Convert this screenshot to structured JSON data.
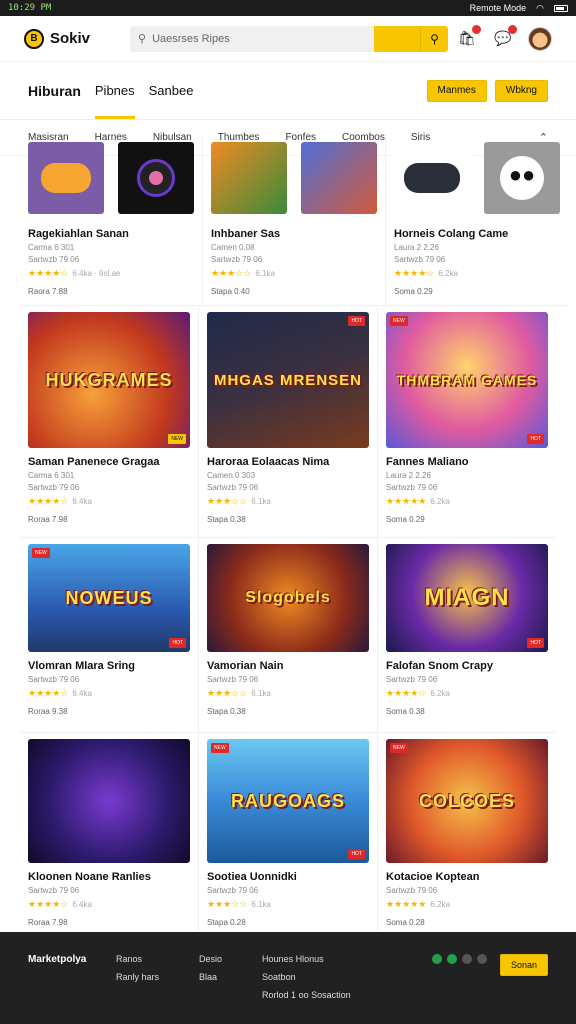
{
  "status": {
    "left": "10:29 PM",
    "right_text": "Remote Mode"
  },
  "header": {
    "logo_mark": "B",
    "logo_text": "Sokiv",
    "search_placeholder": "Uaesrses Ripes",
    "icons": [
      "bag-icon",
      "chat-icon",
      "avatar"
    ]
  },
  "tabs": [
    {
      "label": "Hiburan"
    },
    {
      "label": "Pibnes"
    },
    {
      "label": "Sanbee"
    }
  ],
  "tab_actions": [
    "Manmes",
    "Wbkng"
  ],
  "categories": [
    "Masisran",
    "Harnes",
    "Nibulsan",
    "Thumbes",
    "Fonfes",
    "Coombos",
    "Siris"
  ],
  "rows": [
    {
      "type": "thumbs",
      "cells": [
        {
          "title": "Ragekiahlan Sanan",
          "sub1": "Carma 6 301",
          "sub2": "Sartwzb 79 06",
          "stars": "★★★★☆",
          "rating": "6.4ka · 9sl.ae",
          "price": "Raora 7.88"
        },
        {
          "title": "Inhbaner Sas",
          "sub1": "Camen 0.08",
          "sub2": "Sartwzb 79 06",
          "stars": "★★★☆☆",
          "rating": "6.1ka",
          "price": "Stapa 0.40"
        },
        {
          "title": "Horneis Colang Came",
          "sub1": "Laura 2 2.26",
          "sub2": "Sartwzb 79 06",
          "stars": "★★★★☆",
          "rating": "6.2ka",
          "price": "Soma 0.29"
        }
      ]
    },
    {
      "type": "banner",
      "cells": [
        {
          "banner": "HUKGRAMES",
          "title": "Saman Panenece Gragaa",
          "sub1": "Carma 6 301",
          "sub2": "Sartwzb 79 06",
          "stars": "★★★★☆",
          "rating": "6.4ka",
          "price": "Roraa 7.98"
        },
        {
          "banner": "MHGAS MRENSEN",
          "title": "Haroraa Eolaacas Nima",
          "sub1": "Camen 0 303",
          "sub2": "Sartwzb 79 06",
          "stars": "★★★☆☆",
          "rating": "6.1ka",
          "price": "Stapa 0.38"
        },
        {
          "banner": "THMBRAM GAMES",
          "title": "Fannes Maliano",
          "sub1": "Laura 2 2.26",
          "sub2": "Sartwzb 79 06",
          "stars": "★★★★★",
          "rating": "6.2ka",
          "price": "Soma 0.29"
        }
      ]
    },
    {
      "type": "banner",
      "cells": [
        {
          "banner": "NOWEUS",
          "title": "Vlomran Mlara Sring",
          "sub1": "Sartwzb 79 06",
          "stars": "★★★★☆",
          "rating": "6.4ka",
          "price": "Roraa 9.38"
        },
        {
          "banner": "Slogobels",
          "title": "Vamorian Nain",
          "sub1": "Sartwzb 79 06",
          "stars": "★★★☆☆",
          "rating": "6.1ka",
          "price": "Stapa 0.38"
        },
        {
          "banner": "MIAGN",
          "title": "Falofan Snom Crapy",
          "sub1": "Sartwzb 79 06",
          "stars": "★★★★☆",
          "rating": "6.2ka",
          "price": "Soma 0.38"
        }
      ]
    },
    {
      "type": "banner",
      "cells": [
        {
          "banner": "",
          "title": "Kloonen Noane Ranlies",
          "sub1": "Sartwzb 79 06",
          "stars": "★★★★☆",
          "rating": "6.4ka",
          "price": "Roraa 7.98"
        },
        {
          "banner": "RAUGOAGS",
          "title": "Sootiea Uonnidki",
          "sub1": "Sartwzb 79 06",
          "stars": "★★★☆☆",
          "rating": "6.1ka",
          "price": "Stapa 0.28"
        },
        {
          "banner": "COLCOES",
          "title": "Kotacioe Koptean",
          "sub1": "Sartwzb 79 06",
          "stars": "★★★★★",
          "rating": "6.2ka",
          "price": "Soma 0.28"
        }
      ]
    }
  ],
  "footer": {
    "brand": "Marketpolya",
    "col1": [
      "Ranos",
      "Ranly hars"
    ],
    "col2": [
      "Desio",
      "Blaa"
    ],
    "col3": [
      "Hounes Hlonus",
      "Soatbon",
      "Rorlod 1 oo Sosaction"
    ],
    "button": "Sonan"
  },
  "colors": {
    "accent": "#f7c600",
    "footer_bg": "#212121"
  }
}
